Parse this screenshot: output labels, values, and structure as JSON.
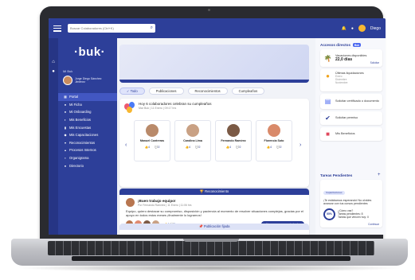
{
  "topbar": {
    "search_placeholder": "Buscar Colaboradores (Ctrl+K)",
    "bell_icon": "bell-icon",
    "help_icon": "help-icon",
    "user_name": "Diego"
  },
  "sidebar": {
    "logo": "·buk·",
    "company": "Mi Buk",
    "user_name": "Jorge Diego Sánchez Jiménez",
    "items": [
      {
        "icon": "▦",
        "label": "Portal"
      },
      {
        "icon": "●",
        "label": "Mi Ficha"
      },
      {
        "icon": "●",
        "label": "Mi Onboarding"
      },
      {
        "icon": "◐",
        "label": "Mis Beneficios"
      },
      {
        "icon": "▮",
        "label": "Mis Encuestas"
      },
      {
        "icon": "◆",
        "label": "Mis Capacitaciones"
      },
      {
        "icon": "▾",
        "label": "Reconocimientos"
      },
      {
        "icon": "▴",
        "label": "Procesos Internos"
      },
      {
        "icon": "▪",
        "label": "Organigrama"
      },
      {
        "icon": "●",
        "label": "Directorio"
      }
    ]
  },
  "tabs": [
    {
      "label": "✓ Todo"
    },
    {
      "label": "Publicaciones"
    },
    {
      "label": "Reconocimientos"
    },
    {
      "label": "Cumpleaños"
    }
  ],
  "birthday": {
    "title": "Hoy 6 colaboradores celebran su cumpleaños",
    "meta": "Mar Buk | 11 Enero | 09:17 hrs",
    "people": [
      {
        "name": "Manuel Contreras",
        "color": "#b98a6a",
        "likes": "4",
        "comments": "2"
      },
      {
        "name": "Carolina Lima",
        "color": "#c9a184",
        "likes": "4",
        "comments": "2"
      },
      {
        "name": "Fernando Ramírez",
        "color": "#7b5a45",
        "likes": "4",
        "comments": "2"
      },
      {
        "name": "Florencia Soto",
        "color": "#d98a6a",
        "likes": "4",
        "comments": "2"
      }
    ]
  },
  "recognition": {
    "header": "🏆 Reconocimiento",
    "title": "¡Buen trabajo equipo!",
    "meta": "Por Fernando Ramírez | 11 Enero | 11:06 hrs",
    "text": "Equipo, quiero destacar su compromiso, disposición y paciencia al momento de resolver situaciones complejas, gracias por el apoyo en todos estos meses ¡finalmente lo logramos!",
    "likes": "6",
    "comments": "2",
    "button": "Hacer un reconocimiento",
    "avatars": [
      "#b87650",
      "#e08a70",
      "#7d5a45",
      "#c9a184"
    ]
  },
  "pinned": "📌 Publicación fijada",
  "right": {
    "title": "Accesos directos",
    "badge": "Buk",
    "vacations_label": "Vacaciones disponibles",
    "vacations_value": "22,0 días",
    "vacations_link": "Solicitar",
    "payroll_label": "Últimas liquidaciones",
    "payroll_rows": [
      "Enero",
      "Diciembre",
      "Noviembre"
    ],
    "cert_label": "Solicitar certificado o documento",
    "perm_label": "Solicitar permiso",
    "benefits_label": "Mis Beneficios",
    "tasks_title": "Tareas Pendientes",
    "task_chip": "Capacitaciones",
    "task_text": "¡Te estábamos esperando! No olvides avanzar con tus cursos pendientes",
    "ring_value": "55%",
    "task_lines": [
      "¿Cómo vas?",
      "Tareas pendientes: 8",
      "Tareas que vencen hoy: 0"
    ],
    "task_link": "Continuar"
  }
}
